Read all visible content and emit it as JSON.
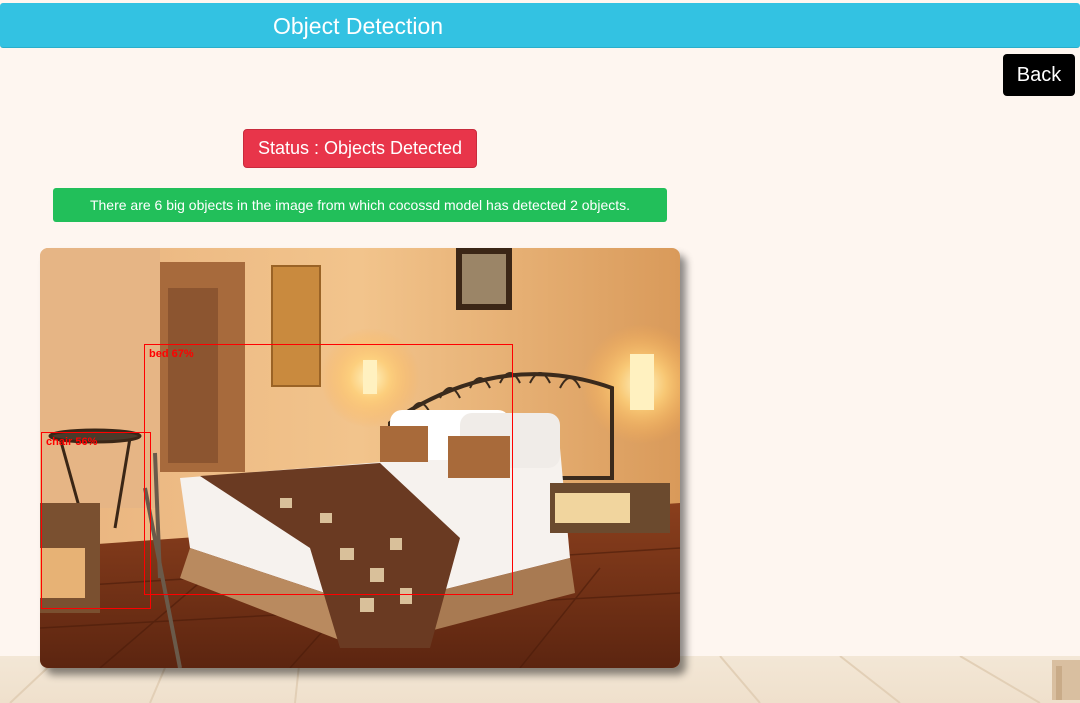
{
  "header": {
    "title": "Object Detection"
  },
  "toolbar": {
    "back_label": "Back"
  },
  "status": {
    "text": "Status : Objects Detected"
  },
  "info": {
    "text": "There are 6 big objects in the image from which cocossd model has detected 2 objects."
  },
  "detections": [
    {
      "label": "bed 67%"
    },
    {
      "label": "chair 56%"
    }
  ],
  "colors": {
    "header_bg": "#33c2e2",
    "status_bg": "#e8354a",
    "info_bg": "#22bf5a",
    "box_color": "#ff0000",
    "page_bg": "#fef6f0"
  }
}
